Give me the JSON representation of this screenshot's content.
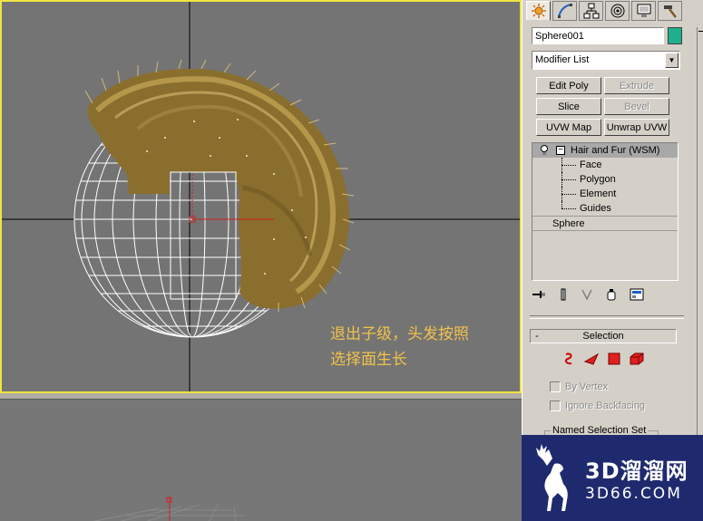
{
  "viewport": {
    "annotation_line1": "退出子级，头发按照",
    "annotation_line2": "选择面生长"
  },
  "command_panel": {
    "tabs": [
      {
        "icon": "create-sun-icon"
      },
      {
        "icon": "modify-curve-icon"
      },
      {
        "icon": "hierarchy-icon"
      },
      {
        "icon": "motion-icon"
      },
      {
        "icon": "display-monitor-icon"
      },
      {
        "icon": "utilities-hammer-icon"
      }
    ],
    "object_name": "Sphere001",
    "object_color": "#1fae8e",
    "modifier_list": "Modifier List",
    "buttons": {
      "edit_poly": "Edit Poly",
      "extrude": "Extrude",
      "slice": "Slice",
      "bevel": "Bevel",
      "uvw_map": "UVW Map",
      "unwrap_uvw": "Unwrap UVW"
    },
    "stack": {
      "hair_and_fur": "Hair and Fur (WSM)",
      "face": "Face",
      "polygon": "Polygon",
      "element": "Element",
      "guides": "Guides",
      "sphere": "Sphere"
    },
    "selection": {
      "minus": "-",
      "title": "Selection",
      "by_vertex": "By Vertex",
      "ignore_backfacing": "Ignore Backfacing",
      "named_selection_set": "Named Selection Set"
    }
  },
  "watermark": {
    "logo_text": "3D溜溜网",
    "domain": "3D66.COM"
  }
}
